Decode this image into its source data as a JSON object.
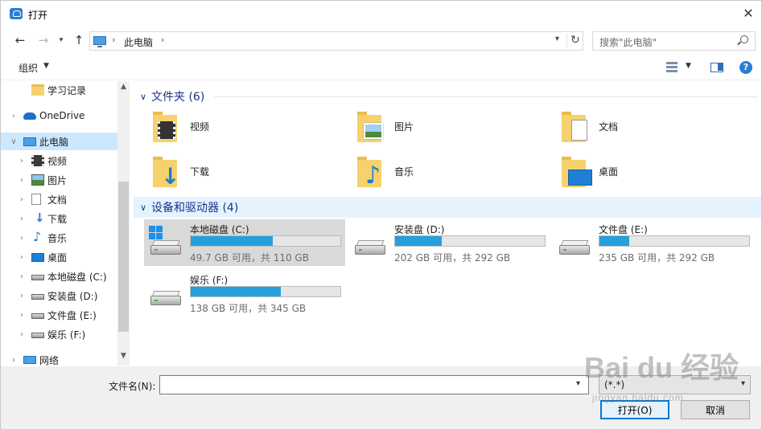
{
  "window": {
    "title": "打开",
    "icon": "cloud-app-icon"
  },
  "nav": {
    "back_icon": "arrow-left-icon",
    "forward_icon": "arrow-right-icon",
    "recent_icon": "chevron-down-icon",
    "up_icon": "arrow-up-icon",
    "address": "此电脑",
    "search_placeholder": "搜索\"此电脑\""
  },
  "toolbar": {
    "organize_label": "组织"
  },
  "sidebar": {
    "items": [
      {
        "label": "学习记录",
        "icon": "folder-icon",
        "indent": 2,
        "expand": false
      },
      {
        "label": "OneDrive",
        "icon": "onedrive-cloud-icon",
        "indent": 1,
        "expand": true
      },
      {
        "label": "此电脑",
        "icon": "pc-icon",
        "indent": 1,
        "expand": true,
        "expanded": true,
        "selected": true
      },
      {
        "label": "视频",
        "icon": "video-folder-icon",
        "indent": 2,
        "expand": true
      },
      {
        "label": "图片",
        "icon": "pictures-folder-icon",
        "indent": 2,
        "expand": true
      },
      {
        "label": "文档",
        "icon": "documents-folder-icon",
        "indent": 2,
        "expand": true
      },
      {
        "label": "下载",
        "icon": "download-folder-icon",
        "indent": 2,
        "expand": true
      },
      {
        "label": "音乐",
        "icon": "music-folder-icon",
        "indent": 2,
        "expand": true
      },
      {
        "label": "桌面",
        "icon": "desktop-folder-icon",
        "indent": 2,
        "expand": true
      },
      {
        "label": "本地磁盘 (C:)",
        "icon": "system-drive-icon",
        "indent": 2,
        "expand": true
      },
      {
        "label": "安装盘 (D:)",
        "icon": "drive-icon",
        "indent": 2,
        "expand": true
      },
      {
        "label": "文件盘 (E:)",
        "icon": "drive-icon",
        "indent": 2,
        "expand": true
      },
      {
        "label": "娱乐 (F:)",
        "icon": "drive-icon",
        "indent": 2,
        "expand": true
      },
      {
        "label": "网络",
        "icon": "network-icon",
        "indent": 1,
        "expand": true
      }
    ]
  },
  "main": {
    "folders_header": "文件夹 (6)",
    "drives_header": "设备和驱动器 (4)",
    "folders": [
      {
        "label": "视频",
        "icon": "video-folder-icon"
      },
      {
        "label": "图片",
        "icon": "pictures-folder-icon"
      },
      {
        "label": "文档",
        "icon": "documents-folder-icon"
      },
      {
        "label": "下载",
        "icon": "download-folder-icon"
      },
      {
        "label": "音乐",
        "icon": "music-folder-icon"
      },
      {
        "label": "桌面",
        "icon": "desktop-folder-icon"
      }
    ],
    "drives": [
      {
        "name": "本地磁盘 (C:)",
        "info": "49.7 GB 可用，共 110 GB",
        "used_fraction": 0.55,
        "system": true,
        "selected": true
      },
      {
        "name": "安装盘 (D:)",
        "info": "202 GB 可用，共 292 GB",
        "used_fraction": 0.31,
        "system": false,
        "selected": false
      },
      {
        "name": "文件盘 (E:)",
        "info": "235 GB 可用，共 292 GB",
        "used_fraction": 0.2,
        "system": false,
        "selected": false
      },
      {
        "name": "娱乐 (F:)",
        "info": "138 GB 可用，共 345 GB",
        "used_fraction": 0.6,
        "system": false,
        "selected": false
      }
    ]
  },
  "bottom": {
    "filename_label": "文件名(N):",
    "filename_value": "",
    "filetype_value": "(*.*)",
    "open_label": "打开(O)",
    "cancel_label": "取消"
  },
  "watermark": {
    "text": "Bai du 经验",
    "sub": "jingyan.baidu.com"
  },
  "colors": {
    "accent": "#0078d7",
    "selection": "#cce8ff",
    "bar": "#26a0da",
    "group_title": "#1e3287",
    "folder": "#f6d16d"
  }
}
